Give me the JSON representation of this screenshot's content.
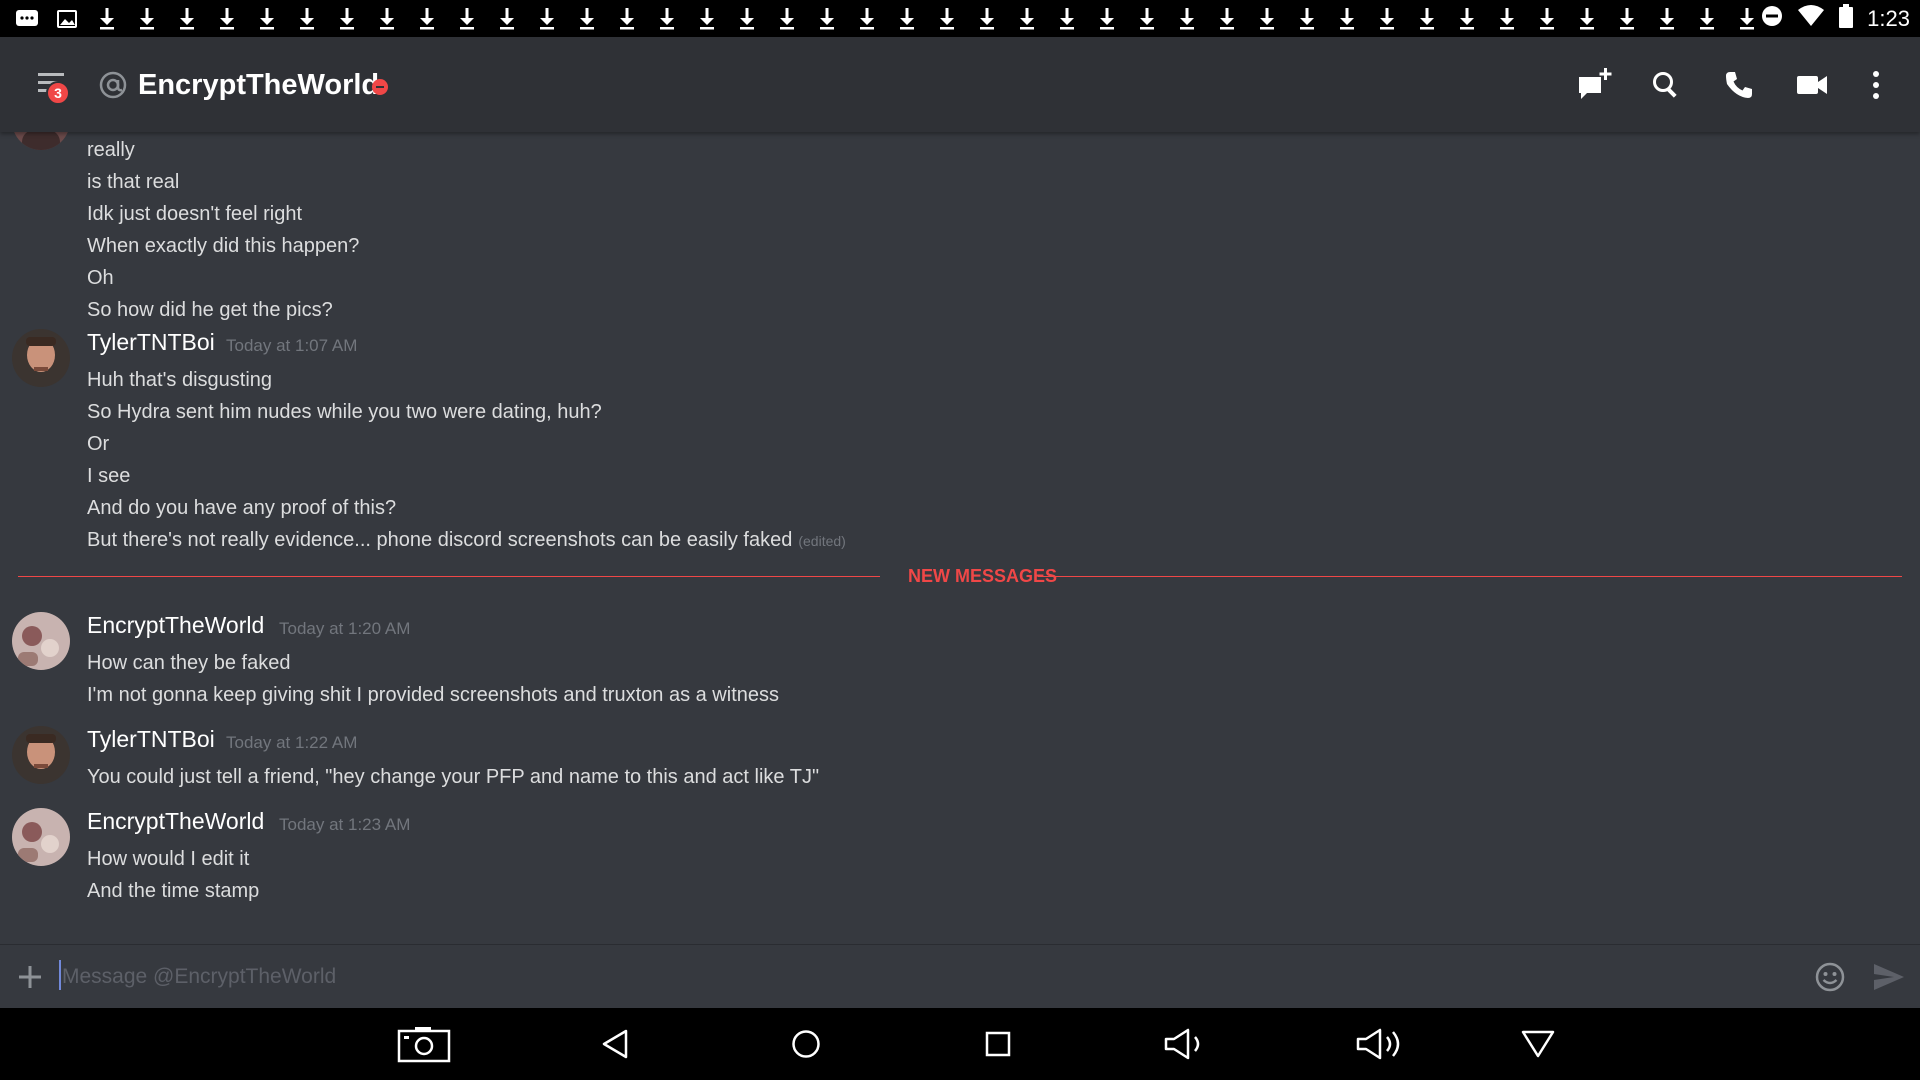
{
  "status_bar": {
    "time": "1:23",
    "notification_icons": [
      "chat-icon",
      "image-icon"
    ],
    "download_count": 42
  },
  "header": {
    "title": "EncryptTheWorld",
    "unread_badge": "3",
    "status": "do-not-disturb",
    "actions": [
      "add-chat-icon",
      "search-icon",
      "phone-icon",
      "video-icon",
      "more-vertical-icon"
    ]
  },
  "messages": {
    "group0": {
      "lines": [
        "really",
        "is that real",
        "Idk just doesn't feel right",
        "When exactly did this happen?",
        "Oh",
        "So how did he get the pics?"
      ]
    },
    "group1": {
      "author": "TylerTNTBoi",
      "timestamp": "Today at 1:07 AM",
      "lines": [
        "Huh that's disgusting",
        "So Hydra sent him nudes while you two were dating, huh?",
        "Or",
        "I see",
        "And do you have any proof of this?",
        "But there's not really evidence... phone discord screenshots can be easily faked"
      ],
      "edited_label": "(edited)"
    },
    "divider_label": "NEW MESSAGES",
    "group2": {
      "author": "EncryptTheWorld",
      "timestamp": "Today at 1:20 AM",
      "lines": [
        "How can they be faked",
        "I'm not gonna keep giving shit I provided screenshots and truxton as a witness"
      ]
    },
    "group3": {
      "author": "TylerTNTBoi",
      "timestamp": "Today at 1:22 AM",
      "lines": [
        "You could just tell a friend, \"hey change your PFP and name to this and act like TJ\""
      ]
    },
    "group4": {
      "author": "EncryptTheWorld",
      "timestamp": "Today at 1:23 AM",
      "lines": [
        "How would I edit it",
        "And the time stamp"
      ]
    }
  },
  "composer": {
    "placeholder": "Message @EncryptTheWorld",
    "value": ""
  },
  "nav_bar": {
    "buttons": [
      "screenshot-icon",
      "back-icon",
      "home-icon",
      "recents-icon",
      "volume-down-icon",
      "volume-up-icon",
      "collapse-icon"
    ]
  },
  "colors": {
    "background": "#36393f",
    "header": "#2f3136",
    "accent_red": "#f04747",
    "text": "#dcddde",
    "muted": "#72767d"
  }
}
